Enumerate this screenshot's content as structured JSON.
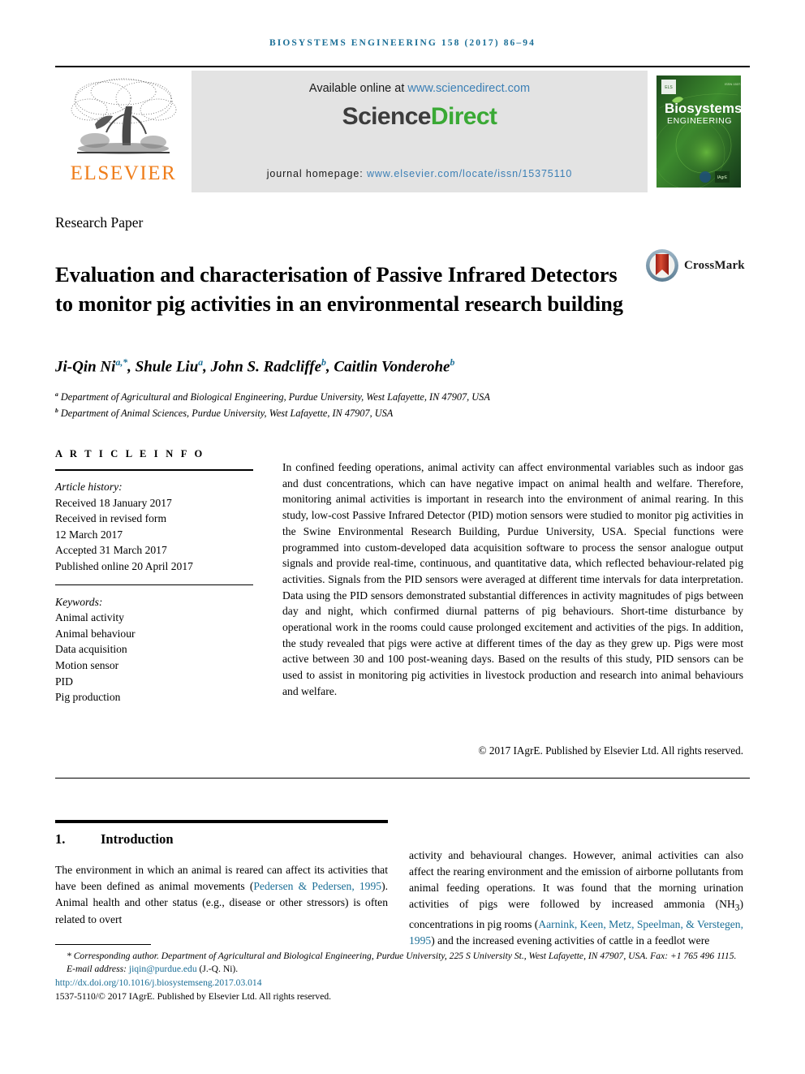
{
  "running_head": "BIOSYSTEMS ENGINEERING 158 (2017) 86–94",
  "masthead": {
    "publisher_name": "ELSEVIER",
    "available_prefix": "Available online at ",
    "available_url": "www.sciencedirect.com",
    "sciencedirect_part1": "Science",
    "sciencedirect_part2": "Direct",
    "homepage_label": "journal homepage: ",
    "homepage_url": "www.elsevier.com/locate/issn/15375110",
    "cover_title_line1": "Biosystems",
    "cover_title_line2": "ENGINEERING"
  },
  "article_type": "Research Paper",
  "title": "Evaluation and characterisation of Passive Infrared Detectors to monitor pig activities in an environmental research building",
  "crossmark_label": "CrossMark",
  "authors": "Ji-Qin Ni",
  "authors_full": [
    {
      "name": "Ji-Qin Ni",
      "sup": "a,*"
    },
    {
      "name": "Shule Liu",
      "sup": "a"
    },
    {
      "name": "John S. Radcliffe",
      "sup": "b"
    },
    {
      "name": "Caitlin Vonderohe",
      "sup": "b"
    }
  ],
  "affiliations": [
    {
      "marker": "a",
      "text": "Department of Agricultural and Biological Engineering, Purdue University, West Lafayette, IN 47907, USA"
    },
    {
      "marker": "b",
      "text": "Department of Animal Sciences, Purdue University, West Lafayette, IN 47907, USA"
    }
  ],
  "article_info": {
    "heading": "A R T I C L E   I N F O",
    "history_label": "Article history:",
    "history": [
      "Received 18 January 2017",
      "Received in revised form",
      "12 March 2017",
      "Accepted 31 March 2017",
      "Published online 20 April 2017"
    ],
    "keywords_label": "Keywords:",
    "keywords": [
      "Animal activity",
      "Animal behaviour",
      "Data acquisition",
      "Motion sensor",
      "PID",
      "Pig production"
    ]
  },
  "abstract": "In confined feeding operations, animal activity can affect environmental variables such as indoor gas and dust concentrations, which can have negative impact on animal health and welfare. Therefore, monitoring animal activities is important in research into the environment of animal rearing. In this study, low-cost Passive Infrared Detector (PID) motion sensors were studied to monitor pig activities in the Swine Environmental Research Building, Purdue University, USA. Special functions were programmed into custom-developed data acquisition software to process the sensor analogue output signals and provide real-time, continuous, and quantitative data, which reflected behaviour-related pig activities. Signals from the PID sensors were averaged at different time intervals for data interpretation. Data using the PID sensors demonstrated substantial differences in activity magnitudes of pigs between day and night, which confirmed diurnal patterns of pig behaviours. Short-time disturbance by operational work in the rooms could cause prolonged excitement and activities of the pigs. In addition, the study revealed that pigs were active at different times of the day as they grew up. Pigs were most active between 30 and 100 post-weaning days. Based on the results of this study, PID sensors can be used to assist in monitoring pig activities in livestock production and research into animal behaviours and welfare.",
  "copyright_line": "© 2017 IAgrE. Published by Elsevier Ltd. All rights reserved.",
  "section": {
    "number": "1.",
    "heading": "Introduction"
  },
  "body_left": {
    "part1": "The environment in which an animal is reared can affect its activities that have been defined as animal movements (",
    "cite1": "Pedersen & Pedersen, 1995",
    "part2": "). Animal health and other status (e.g., disease or other stressors) is often related to overt"
  },
  "body_right": {
    "part1": "activity and behavioural changes. However, animal activities can also affect the rearing environment and the emission of airborne pollutants from animal feeding operations. It was found that the morning urination activities of pigs were followed by increased ammonia (NH",
    "sub1": "3",
    "part2": ") concentrations in pig rooms (",
    "cite1": "Aarnink, Keen, Metz, Speelman, & Verstegen, 1995",
    "part3": ") and the increased evening activities of cattle in a feedlot were"
  },
  "footnotes": {
    "corresponding": "* Corresponding author. Department of Agricultural and Biological Engineering, Purdue University, 225 S University St., West Lafayette, IN 47907, USA. Fax: +1 765 496 1115.",
    "email_label": "E-mail address: ",
    "email": "jiqin@purdue.edu",
    "email_suffix": " (J.-Q. Ni).",
    "doi": "http://dx.doi.org/10.1016/j.biosystemseng.2017.03.014",
    "issn_line": "1537-5110/© 2017 IAgrE. Published by Elsevier Ltd. All rights reserved."
  },
  "colors": {
    "journal_header": "#1a6e96",
    "elsevier_orange": "#ef7d1a",
    "sciencedirect_green": "#3aa935",
    "link_blue": "#3b7fb5",
    "citation_blue": "#1a6e96",
    "band_gray": "#e3e3e3"
  }
}
